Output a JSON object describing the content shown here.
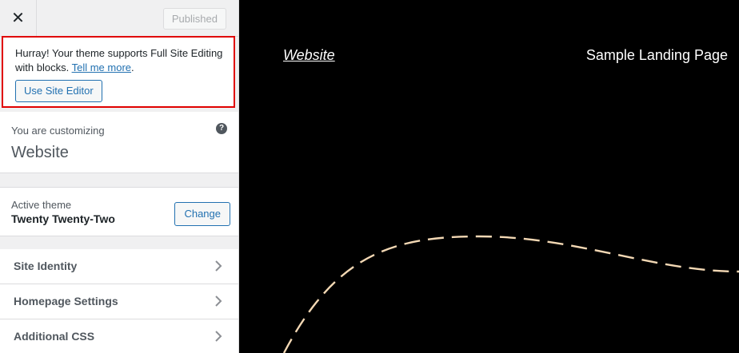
{
  "topbar": {
    "close_label": "✕",
    "published_label": "Published"
  },
  "notice": {
    "text": "Hurray! Your theme supports Full Site Editing with blocks.",
    "link": "Tell me more",
    "tail": ".",
    "button": "Use Site Editor"
  },
  "customizing": {
    "label": "You are customizing",
    "site": "Website",
    "help": "?"
  },
  "theme": {
    "label": "Active theme",
    "name": "Twenty Twenty-Two",
    "change": "Change"
  },
  "sections": [
    "Site Identity",
    "Homepage Settings",
    "Additional CSS"
  ],
  "preview": {
    "site_title": "Website",
    "nav_link": "Sample Landing Page",
    "curve_color": "#f3d8b4"
  }
}
